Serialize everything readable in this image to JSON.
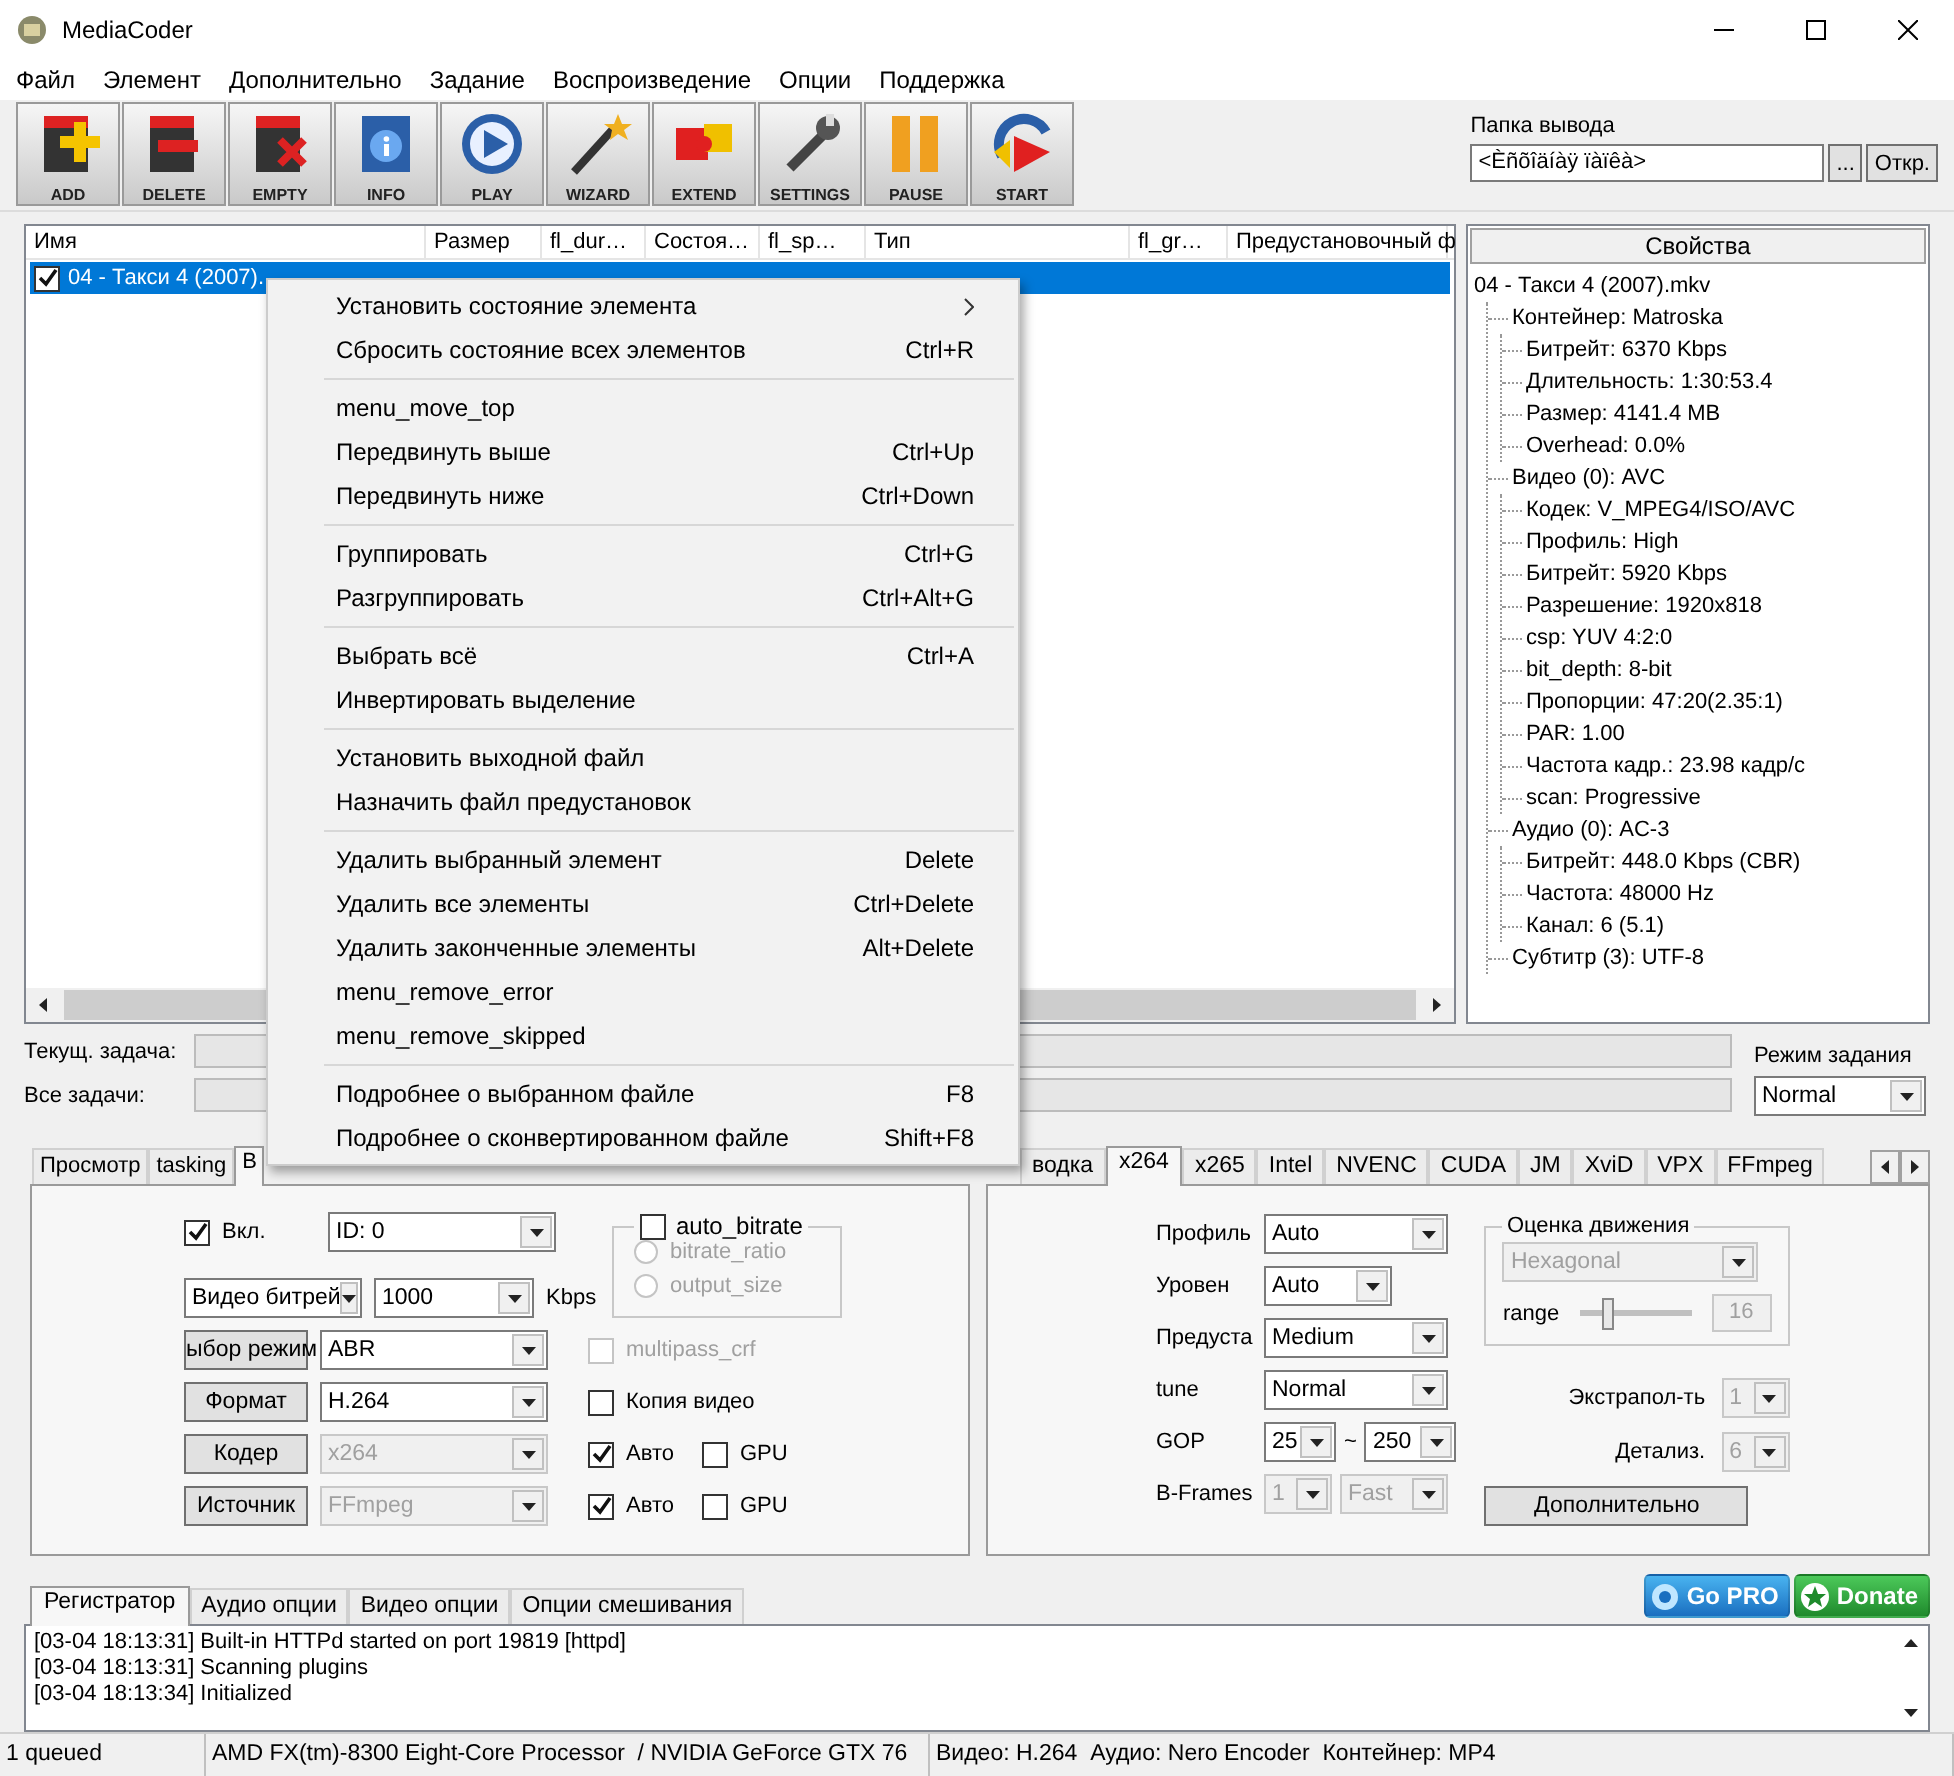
{
  "window": {
    "title": "MediaCoder"
  },
  "menu_bar": [
    "Файл",
    "Элемент",
    "Дополнительно",
    "Задание",
    "Воспроизведение",
    "Опции",
    "Поддержка"
  ],
  "toolbar": [
    {
      "label": "ADD",
      "kind": "add"
    },
    {
      "label": "DELETE",
      "kind": "delete"
    },
    {
      "label": "EMPTY",
      "kind": "empty"
    },
    {
      "label": "INFO",
      "kind": "info"
    },
    {
      "label": "PLAY",
      "kind": "play"
    },
    {
      "label": "WIZARD",
      "kind": "wizard"
    },
    {
      "label": "EXTEND",
      "kind": "extend"
    },
    {
      "label": "SETTINGS",
      "kind": "settings"
    },
    {
      "label": "PAUSE",
      "kind": "pause"
    },
    {
      "label": "START",
      "kind": "start"
    }
  ],
  "output_folder": {
    "label": "Папка вывода",
    "value": "<Èñõîäíàÿ ïàïêà>",
    "browse": "...",
    "open": "Откр."
  },
  "file_list": {
    "columns": [
      "Имя",
      "Размер",
      "fl_dur…",
      "Состоя…",
      "fl_sp…",
      "Тип",
      "fl_gr…",
      "Предустановочный ф"
    ],
    "rows": [
      {
        "name": "04 - Такси 4 (2007).",
        "checked": true,
        "selected": true
      }
    ]
  },
  "properties": {
    "title": "Свойства",
    "tree": [
      {
        "label": "04 - Такси 4 (2007).mkv",
        "children": [
          {
            "label": "Контейнер: Matroska",
            "children": [
              {
                "label": "Битрейт: 6370 Kbps"
              },
              {
                "label": "Длительность: 1:30:53.4"
              },
              {
                "label": "Размер: 4141.4 MB"
              },
              {
                "label": "Overhead: 0.0%"
              }
            ]
          },
          {
            "label": "Видео (0): AVC",
            "children": [
              {
                "label": "Кодек: V_MPEG4/ISO/AVC"
              },
              {
                "label": "Профиль: High"
              },
              {
                "label": "Битрейт: 5920 Kbps"
              },
              {
                "label": "Разрешение: 1920x818"
              },
              {
                "label": "csp: YUV 4:2:0"
              },
              {
                "label": "bit_depth: 8-bit"
              },
              {
                "label": "Пропорции: 47:20(2.35:1)"
              },
              {
                "label": "PAR: 1.00"
              },
              {
                "label": "Частота кадр.: 23.98 кадр/с"
              },
              {
                "label": "scan: Progressive"
              }
            ]
          },
          {
            "label": "Аудио (0): AC-3",
            "children": [
              {
                "label": "Битрейт: 448.0 Kbps (CBR)"
              },
              {
                "label": "Частота: 48000 Hz"
              },
              {
                "label": "Канал: 6 (5.1)"
              }
            ]
          },
          {
            "label": "Субтитр (3): UTF-8"
          }
        ]
      }
    ]
  },
  "progress": [
    {
      "label": "Текущ. задача:",
      "level": 0
    },
    {
      "label": "Все задачи:",
      "level": 0
    }
  ],
  "job_mode": {
    "label": "Режим задания",
    "value": "Normal"
  },
  "context_menu": {
    "groups": [
      [
        {
          "label": "Установить состояние элемента",
          "submenu": true
        },
        {
          "label": "Сбросить состояние всех элементов",
          "shortcut": "Ctrl+R"
        }
      ],
      [
        {
          "label": "menu_move_top"
        },
        {
          "label": "Передвинуть выше",
          "shortcut": "Ctrl+Up"
        },
        {
          "label": "Передвинуть ниже",
          "shortcut": "Ctrl+Down"
        }
      ],
      [
        {
          "label": "Группировать",
          "shortcut": "Ctrl+G"
        },
        {
          "label": "Разгруппировать",
          "shortcut": "Ctrl+Alt+G"
        }
      ],
      [
        {
          "label": "Выбрать всё",
          "shortcut": "Ctrl+A"
        },
        {
          "label": "Инвертировать выделение"
        }
      ],
      [
        {
          "label": "Установить выходной файл"
        },
        {
          "label": "Назначить файл предустановок"
        }
      ],
      [
        {
          "label": "Удалить выбранный элемент",
          "shortcut": "Delete"
        },
        {
          "label": "Удалить все элементы",
          "shortcut": "Ctrl+Delete"
        },
        {
          "label": "Удалить законченные элементы",
          "shortcut": "Alt+Delete"
        },
        {
          "label": "menu_remove_error"
        },
        {
          "label": "menu_remove_skipped"
        }
      ],
      [
        {
          "label": "Подробнее о выбранном файле",
          "shortcut": "F8"
        },
        {
          "label": "Подробнее о сконвертированном файле",
          "shortcut": "Shift+F8"
        }
      ]
    ]
  },
  "video_tabs": [
    {
      "label": "Просмотр",
      "selected": false
    },
    {
      "label": "tasking",
      "selected": false
    },
    {
      "label": "В",
      "selected": true
    }
  ],
  "video_panel": {
    "enable": {
      "label": "Вкл.",
      "checked": true
    },
    "stream": "ID: 0",
    "bitrate_mode": "Видео битрей",
    "bitrate": "1000",
    "unit": "Kbps",
    "auto_bitrate": {
      "label": "auto_bitrate",
      "checked": false,
      "options": [
        {
          "label": "bitrate_ratio",
          "selected": false,
          "disabled": true
        },
        {
          "label": "output_size",
          "selected": false,
          "disabled": true
        }
      ]
    },
    "rows": [
      {
        "button": "ыбор режим",
        "value": "ABR",
        "disabled": false,
        "extras": [
          {
            "label": "multipass_crf",
            "checked": false,
            "disabled": true
          }
        ]
      },
      {
        "button": "Формат",
        "value": "H.264",
        "disabled": false,
        "extras": [
          {
            "label": "Копия видео",
            "checked": false,
            "disabled": false
          }
        ]
      },
      {
        "button": "Кодер",
        "value": "x264",
        "disabled": true,
        "extras": [
          {
            "label": "Авто",
            "checked": true,
            "disabled": false
          },
          {
            "label": "GPU",
            "checked": false,
            "disabled": false
          }
        ]
      },
      {
        "button": "Источник",
        "value": "FFmpeg",
        "disabled": true,
        "extras": [
          {
            "label": "Авто",
            "checked": true,
            "disabled": false
          },
          {
            "label": "GPU",
            "checked": false,
            "disabled": false
          }
        ]
      }
    ]
  },
  "codec_tabs": [
    {
      "label": "водка",
      "selected": false
    },
    {
      "label": "x264",
      "selected": true
    },
    {
      "label": "x265",
      "selected": false
    },
    {
      "label": "Intel",
      "selected": false
    },
    {
      "label": "NVENC",
      "selected": false
    },
    {
      "label": "CUDA",
      "selected": false
    },
    {
      "label": "JM",
      "selected": false
    },
    {
      "label": "XviD",
      "selected": false
    },
    {
      "label": "VPX",
      "selected": false
    },
    {
      "label": "FFmpeg",
      "selected": false
    }
  ],
  "x264_panel": {
    "fields": [
      {
        "label": "Профиль",
        "kind": "wide",
        "values": [
          "Auto"
        ],
        "disabled": false
      },
      {
        "label": "Уровен",
        "kind": "short",
        "values": [
          "Auto"
        ],
        "disabled": false
      },
      {
        "label": "Предуста",
        "kind": "wide",
        "values": [
          "Medium"
        ],
        "disabled": false
      },
      {
        "label": "tune",
        "kind": "wide",
        "values": [
          "Normal"
        ],
        "disabled": false
      },
      {
        "label": "GOP",
        "kind": "range",
        "values": [
          "25",
          "250"
        ],
        "separator": "~",
        "disabled": false
      },
      {
        "label": "B-Frames",
        "kind": "pair",
        "values": [
          "1",
          "Fast"
        ],
        "disabled": true
      }
    ],
    "motion": {
      "title": "Оценка движения",
      "method": "Hexagonal",
      "method_disabled": true,
      "range_label": "range",
      "level": 0.25,
      "range_value": "16"
    },
    "extra": [
      {
        "label": "Экстрапол-ть",
        "value": "1",
        "disabled": true
      },
      {
        "label": "Детализ.",
        "value": "6",
        "disabled": true
      }
    ],
    "more_button": "Дополнительно"
  },
  "log_tabs": [
    {
      "label": "Регистратор",
      "selected": true
    },
    {
      "label": "Аудио опции",
      "selected": false
    },
    {
      "label": "Видео опции",
      "selected": false
    },
    {
      "label": "Опции смешивания",
      "selected": false
    }
  ],
  "promo": {
    "go_pro": "Go PRO",
    "donate": "Donate"
  },
  "log": [
    "[03-04 18:13:31] Built-in HTTPd started on port 19819 [httpd]",
    "[03-04 18:13:31] Scanning plugins",
    "[03-04 18:13:34] Initialized"
  ],
  "status_bar": [
    "1 queued",
    "AMD FX(tm)-8300 Eight-Core Processor  / NVIDIA GeForce GTX 76",
    "Видео: H.264  Аудио: Nero Encoder  Контейнер: MP4"
  ]
}
